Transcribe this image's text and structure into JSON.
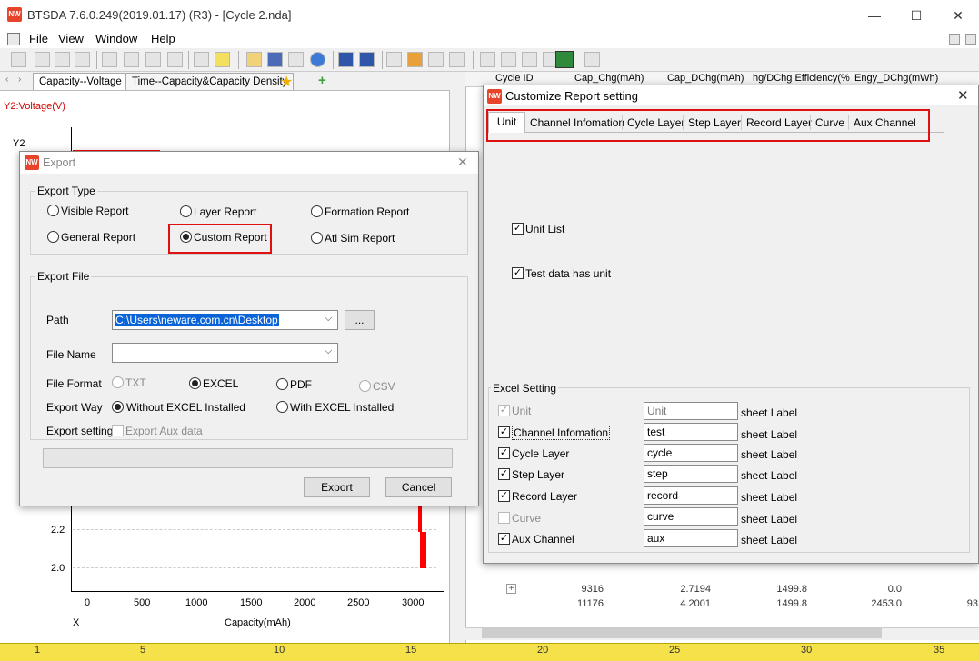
{
  "window": {
    "title": "BTSDA 7.6.0.249(2019.01.17) (R3) - [Cycle 2.nda]",
    "app_icon": "NW",
    "controls": {
      "minimize": "—",
      "maximize": "☐",
      "close": "✕"
    }
  },
  "menu": {
    "items": [
      "File",
      "View",
      "Window",
      "Help"
    ]
  },
  "tabs": {
    "items": [
      "Capacity--Voltage",
      "Time--Capacity&Capacity Density"
    ]
  },
  "chart": {
    "y2_label": "Y2:Voltage(V)",
    "y2_axis_title": "Y2",
    "y_ticks": [
      "2.2",
      "2.0"
    ],
    "x_ticks": [
      "0",
      "500",
      "1000",
      "1500",
      "2000",
      "2500",
      "3000"
    ],
    "x_axis_prefix": "X",
    "x_label": "Capacity(mAh)"
  },
  "grid": {
    "headers": [
      "Cycle ID",
      "Cap_Chg(mAh)",
      "Cap_DChg(mAh)",
      "hg/DChg Efficiency(%",
      "Engy_DChg(mWh)"
    ],
    "rows": [
      [
        "9316",
        "2.7194",
        "1499.8",
        "0.0",
        ""
      ],
      [
        "11176",
        "4.2001",
        "1499.8",
        "2453.0",
        "93"
      ]
    ]
  },
  "ruler": {
    "ticks": [
      "1",
      "5",
      "10",
      "15",
      "20",
      "25",
      "30",
      "35"
    ]
  },
  "export_dialog": {
    "title": "Export",
    "export_type_label": "Export Type",
    "types": [
      "Visible Report",
      "Layer Report",
      "Formation Report",
      "General Report",
      "Custom Report",
      "Atl Sim Report"
    ],
    "selected_type": "Custom Report",
    "export_file_label": "Export File",
    "path_label": "Path",
    "path_value": "C:\\Users\\neware.com.cn\\Desktop",
    "browse_label": "...",
    "file_name_label": "File Name",
    "file_name_value": "",
    "file_format_label": "File Format",
    "formats": [
      "TXT",
      "EXCEL",
      "PDF",
      "CSV"
    ],
    "selected_format": "EXCEL",
    "export_way_label": "Export Way",
    "ways": [
      "Without EXCEL Installed",
      "With EXCEL Installed"
    ],
    "selected_way": "Without EXCEL Installed",
    "export_setting_label": "Export setting",
    "export_aux_label": "Export Aux data",
    "export_button": "Export",
    "cancel_button": "Cancel"
  },
  "report_dialog": {
    "title": "Customize Report setting",
    "tabs": [
      "Unit",
      "Channel Infomation",
      "Cycle Layer",
      "Step Layer",
      "Record Layer",
      "Curve",
      "Aux Channel"
    ],
    "active_tab": "Unit",
    "unit_list_label": "Unit List",
    "test_data_unit_label": "Test data has unit",
    "excel_setting_label": "Excel Setting",
    "sheet_label_text": "sheet Label",
    "sheets": [
      {
        "name": "Unit",
        "value": "Unit",
        "checked": true,
        "disabled": true
      },
      {
        "name": "Channel Infomation",
        "value": "test",
        "checked": true,
        "disabled": false
      },
      {
        "name": "Cycle Layer",
        "value": "cycle",
        "checked": true,
        "disabled": false
      },
      {
        "name": "Step Layer",
        "value": "step",
        "checked": true,
        "disabled": false
      },
      {
        "name": "Record Layer",
        "value": "record",
        "checked": true,
        "disabled": false
      },
      {
        "name": "Curve",
        "value": "curve",
        "checked": false,
        "disabled": true
      },
      {
        "name": "Aux Channel",
        "value": "aux",
        "checked": true,
        "disabled": false
      }
    ],
    "check_mark": "✓"
  },
  "colors": {
    "highlight": "#e01010",
    "selection": "#0a64d8",
    "ruler": "#f5e24a"
  }
}
